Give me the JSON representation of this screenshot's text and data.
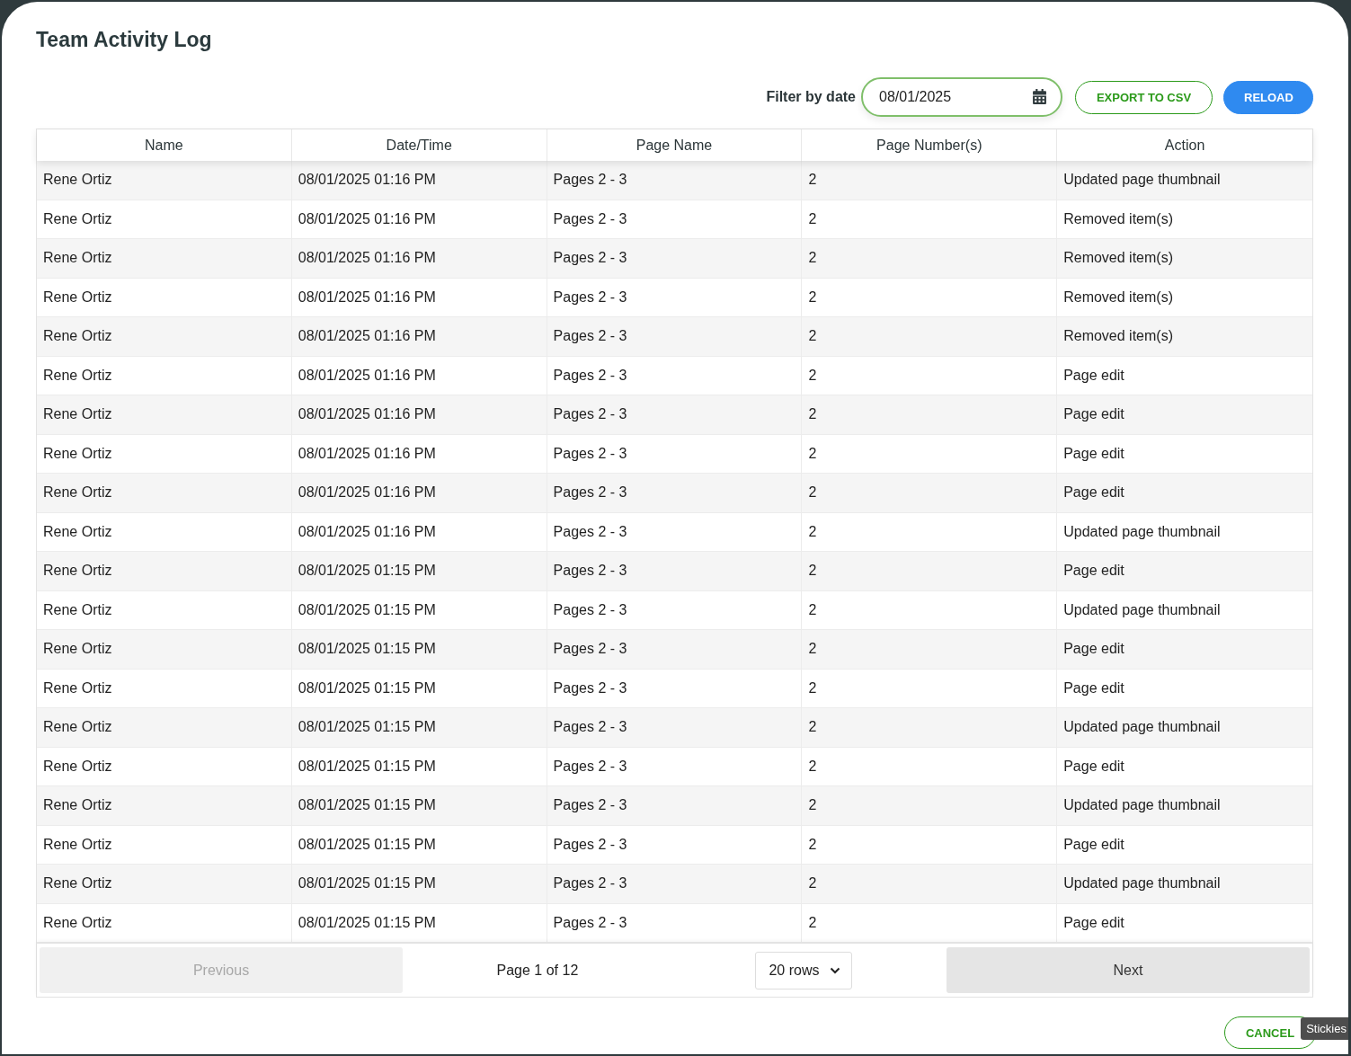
{
  "dialog": {
    "title": "Team Activity Log"
  },
  "toolbar": {
    "filter_label": "Filter by date",
    "date_field": {
      "value": "08/01/2025"
    },
    "export_button": "EXPORT TO CSV",
    "reload_button": "RELOAD"
  },
  "table": {
    "columns": [
      "Name",
      "Date/Time",
      "Page Name",
      "Page Number(s)",
      "Action"
    ],
    "rows": [
      [
        "Rene Ortiz",
        "08/01/2025 01:16 PM",
        "Pages 2 - 3",
        "2",
        "Updated page thumbnail"
      ],
      [
        "Rene Ortiz",
        "08/01/2025 01:16 PM",
        "Pages 2 - 3",
        "2",
        "Removed item(s)"
      ],
      [
        "Rene Ortiz",
        "08/01/2025 01:16 PM",
        "Pages 2 - 3",
        "2",
        "Removed item(s)"
      ],
      [
        "Rene Ortiz",
        "08/01/2025 01:16 PM",
        "Pages 2 - 3",
        "2",
        "Removed item(s)"
      ],
      [
        "Rene Ortiz",
        "08/01/2025 01:16 PM",
        "Pages 2 - 3",
        "2",
        "Removed item(s)"
      ],
      [
        "Rene Ortiz",
        "08/01/2025 01:16 PM",
        "Pages 2 - 3",
        "2",
        "Page edit"
      ],
      [
        "Rene Ortiz",
        "08/01/2025 01:16 PM",
        "Pages 2 - 3",
        "2",
        "Page edit"
      ],
      [
        "Rene Ortiz",
        "08/01/2025 01:16 PM",
        "Pages 2 - 3",
        "2",
        "Page edit"
      ],
      [
        "Rene Ortiz",
        "08/01/2025 01:16 PM",
        "Pages 2 - 3",
        "2",
        "Page edit"
      ],
      [
        "Rene Ortiz",
        "08/01/2025 01:16 PM",
        "Pages 2 - 3",
        "2",
        "Updated page thumbnail"
      ],
      [
        "Rene Ortiz",
        "08/01/2025 01:15 PM",
        "Pages 2 - 3",
        "2",
        "Page edit"
      ],
      [
        "Rene Ortiz",
        "08/01/2025 01:15 PM",
        "Pages 2 - 3",
        "2",
        "Updated page thumbnail"
      ],
      [
        "Rene Ortiz",
        "08/01/2025 01:15 PM",
        "Pages 2 - 3",
        "2",
        "Page edit"
      ],
      [
        "Rene Ortiz",
        "08/01/2025 01:15 PM",
        "Pages 2 - 3",
        "2",
        "Page edit"
      ],
      [
        "Rene Ortiz",
        "08/01/2025 01:15 PM",
        "Pages 2 - 3",
        "2",
        "Updated page thumbnail"
      ],
      [
        "Rene Ortiz",
        "08/01/2025 01:15 PM",
        "Pages 2 - 3",
        "2",
        "Page edit"
      ],
      [
        "Rene Ortiz",
        "08/01/2025 01:15 PM",
        "Pages 2 - 3",
        "2",
        "Updated page thumbnail"
      ],
      [
        "Rene Ortiz",
        "08/01/2025 01:15 PM",
        "Pages 2 - 3",
        "2",
        "Page edit"
      ],
      [
        "Rene Ortiz",
        "08/01/2025 01:15 PM",
        "Pages 2 - 3",
        "2",
        "Updated page thumbnail"
      ],
      [
        "Rene Ortiz",
        "08/01/2025 01:15 PM",
        "Pages 2 - 3",
        "2",
        "Page edit"
      ]
    ]
  },
  "pagination": {
    "previous": {
      "label": "Previous",
      "disabled": true
    },
    "page_info": "Page 1 of 12",
    "rows_select": "20 rows",
    "next": {
      "label": "Next",
      "disabled": false
    }
  },
  "footer": {
    "cancel_button": "CANCEL",
    "tooltip": "Stickies"
  }
}
